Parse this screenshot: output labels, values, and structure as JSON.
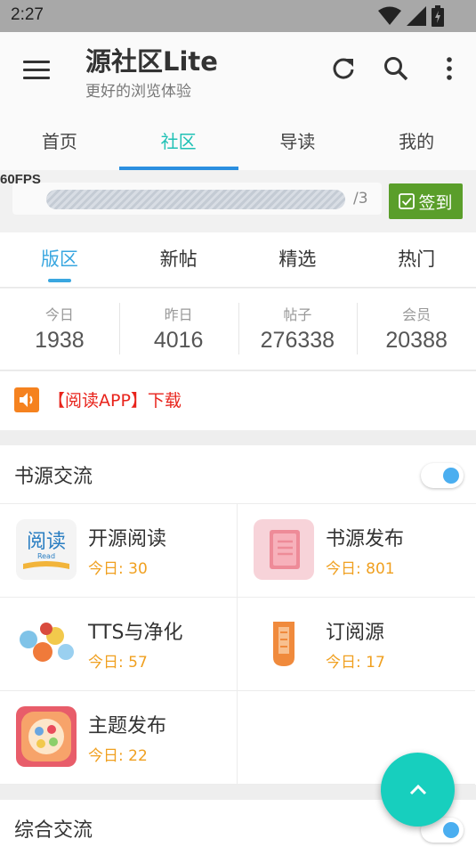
{
  "status_bar": {
    "time": "2:27"
  },
  "app_bar": {
    "title": "源社区Lite",
    "subtitle": "更好的浏览体验"
  },
  "main_tabs": [
    {
      "label": "首页",
      "active": false
    },
    {
      "label": "社区",
      "active": true
    },
    {
      "label": "导读",
      "active": false
    },
    {
      "label": "我的",
      "active": false
    }
  ],
  "fps": "60FPS",
  "checkin": {
    "progress_total": "/3",
    "button_label": "签到"
  },
  "sub_tabs": [
    {
      "label": "版区",
      "active": true
    },
    {
      "label": "新帖",
      "active": false
    },
    {
      "label": "精选",
      "active": false
    },
    {
      "label": "热门",
      "active": false
    }
  ],
  "stats": [
    {
      "label": "今日",
      "value": "1938"
    },
    {
      "label": "昨日",
      "value": "4016"
    },
    {
      "label": "帖子",
      "value": "276338"
    },
    {
      "label": "会员",
      "value": "20388"
    }
  ],
  "notice": {
    "text": "【阅读APP】下载"
  },
  "sections": [
    {
      "title": "书源交流",
      "toggle_on": true,
      "forums": [
        {
          "name": "开源阅读",
          "today": "今日: 30",
          "icon": "read-app-icon"
        },
        {
          "name": "书源发布",
          "today": "今日: 801",
          "icon": "book-source-icon"
        },
        {
          "name": "TTS与净化",
          "today": "今日: 57",
          "icon": "tts-icon"
        },
        {
          "name": "订阅源",
          "today": "今日: 17",
          "icon": "subscribe-icon"
        },
        {
          "name": "主题发布",
          "today": "今日: 22",
          "icon": "theme-icon"
        }
      ]
    },
    {
      "title": "综合交流",
      "toggle_on": true,
      "forums": []
    }
  ],
  "colors": {
    "accent": "#1fc1b5",
    "tab_indicator": "#2b8fe0",
    "sign_button": "#5a9e2a",
    "today_count": "#f0a020",
    "notice": "#e8231b",
    "fab": "#17cfbe"
  }
}
